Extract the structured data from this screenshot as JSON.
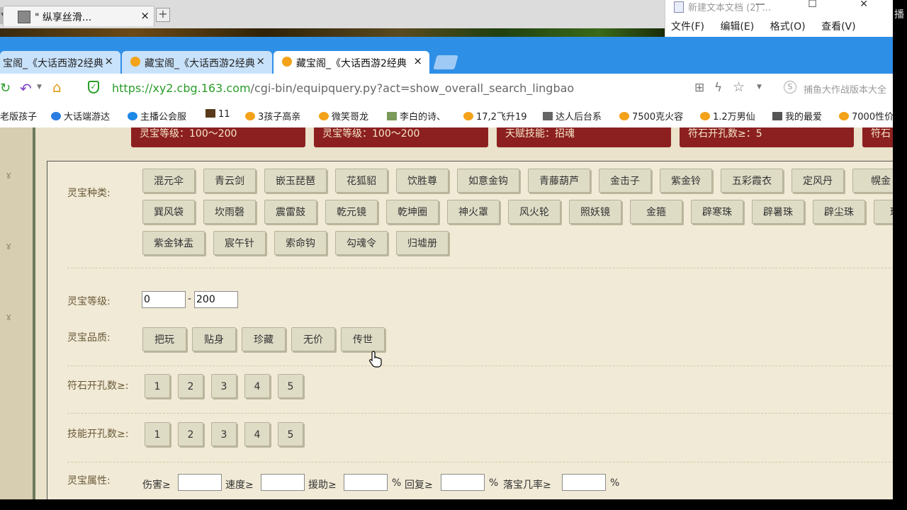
{
  "os": {
    "outer_tab_label": "\" 纵享丝滑...",
    "outer_tab_close": "×",
    "outer_new_tab": "+",
    "notepad_title": "新建文本文档 (2) ...",
    "notepad_controls": "— ☐ ✕",
    "notepad_menu": [
      "文件(F)",
      "编辑(E)",
      "格式(O)",
      "查看(V)"
    ],
    "right_edge_text": "播"
  },
  "browser": {
    "tabs": [
      {
        "label": "宝阁_《大话西游2经典",
        "close": "×"
      },
      {
        "label": "藏宝阁_《大话西游2经典",
        "close": "×"
      },
      {
        "label": "藏宝阁_《大话西游2经典",
        "close": "×"
      }
    ],
    "url_host": "https://xy2.cbg.163.com",
    "url_path": "/cgi-bin/equipquery.py?act=show_overall_search_lingbao",
    "search_text": "捕鱼大作战版本大全",
    "bookmarks": [
      "老版孩子",
      "大话端游达",
      "主播公会服",
      "11",
      "3孩子高亲",
      "微笑哥龙",
      "李白的诗、",
      "17,2飞升19",
      "达人后台系",
      "7500克火容",
      "1.2万男仙",
      "我的最爱",
      "7000性价"
    ]
  },
  "page": {
    "top_tabs": [
      "灵宝等级：100～200",
      "灵宝等级：100～200",
      "天赋技能：招魂",
      "符石开孔数≥：5",
      "符石"
    ],
    "types_label": "灵宝种类:",
    "types": [
      [
        "混元伞",
        "青云剑",
        "嵌玉琵琶",
        "花狐貂",
        "饮胜尊",
        "如意金钩",
        "青藤葫芦",
        "金击子",
        "紫金铃",
        "五彩霞衣",
        "定风丹",
        "幌金"
      ],
      [
        "巽风袋",
        "坎雨磬",
        "震雷鼓",
        "乾元镜",
        "乾坤圈",
        "神火罩",
        "风火轮",
        "照妖镜",
        "金箍",
        "辟寒珠",
        "辟暑珠",
        "辟尘珠",
        "琉璃"
      ],
      [
        "紫金钵盂",
        "宸午针",
        "索命钩",
        "勾魂令",
        "归墟册"
      ]
    ],
    "level_label": "灵宝等级:",
    "level_min": "0",
    "level_dash": "-",
    "level_max": "200",
    "quality_label": "灵宝品质:",
    "qualities": [
      "把玩",
      "贴身",
      "珍藏",
      "无价",
      "传世"
    ],
    "rune_label": "符石开孔数≥:",
    "rune_options": [
      "1",
      "2",
      "3",
      "4",
      "5"
    ],
    "skill_label": "技能开孔数≥:",
    "skill_options": [
      "1",
      "2",
      "3",
      "4",
      "5"
    ],
    "attr_label": "灵宝属性:",
    "attrs": [
      {
        "name": "伤害≥",
        "unit": ""
      },
      {
        "name": "速度≥",
        "unit": ""
      },
      {
        "name": "援助≥",
        "unit": "%"
      },
      {
        "name": "回复≥",
        "unit": "%"
      },
      {
        "name": "落宝几率≥",
        "unit": "%"
      }
    ]
  },
  "colors": {
    "browser_blue": "#2e8fe6",
    "tab_red": "#8c2020",
    "page_bg": "#eae2ca",
    "button_bg": "#dfdcc6"
  }
}
